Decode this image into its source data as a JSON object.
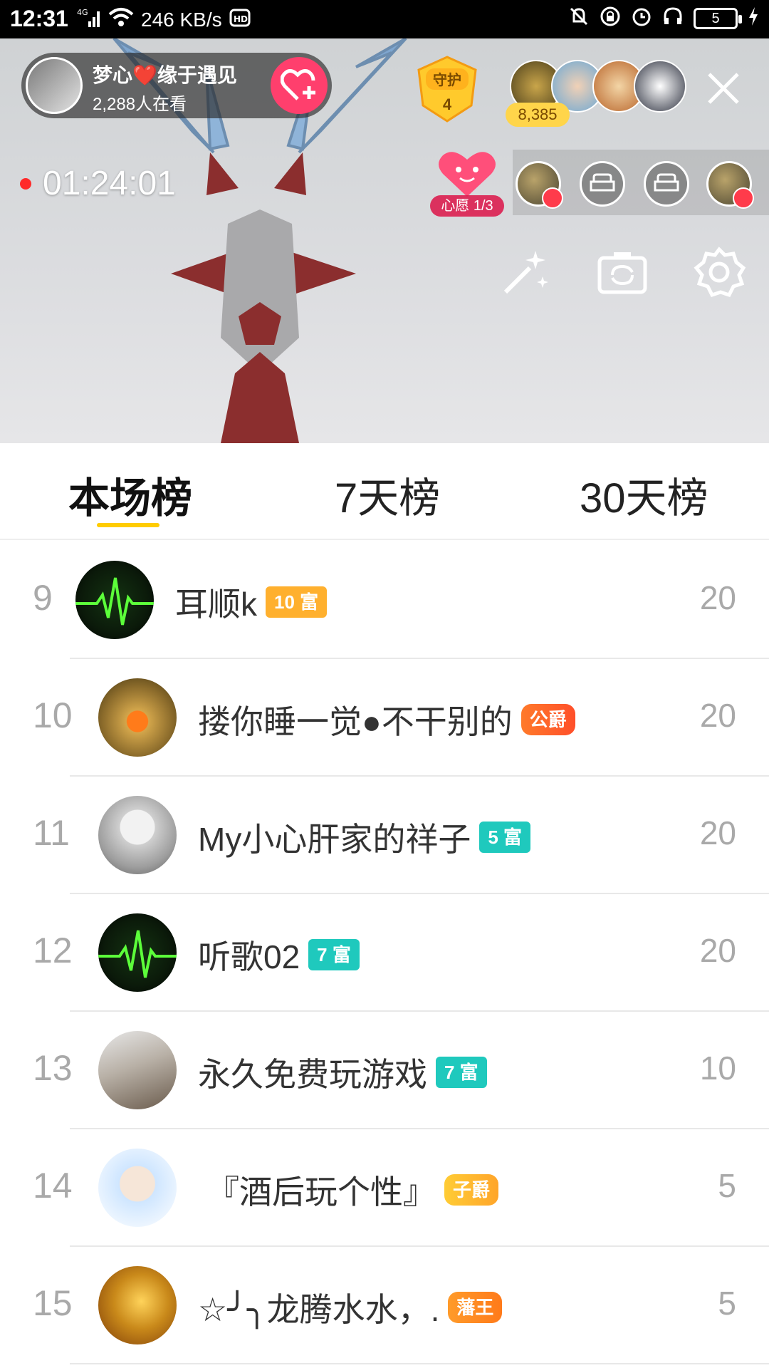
{
  "status_bar": {
    "time": "12:31",
    "network_label": "4G",
    "speed": "246 KB/s",
    "battery_level": "5",
    "icons": [
      "signal-icon",
      "wifi-icon",
      "hd-icon",
      "mute-icon",
      "lock-icon",
      "alarm-icon",
      "headphones-icon",
      "battery-icon",
      "charging-icon"
    ]
  },
  "live": {
    "anchor_name": "梦心❤️缘于遇见",
    "viewers": "2,288人在看",
    "guard_label": "守护",
    "guard_count": "4",
    "audience_count": "8,385",
    "timer": "01:24:01",
    "wish_label": "心愿 1/3",
    "colors": {
      "follow": "#ff3f6d",
      "rec_dot": "#ff2a2a"
    }
  },
  "tabs": [
    {
      "label": "本场榜",
      "active": true
    },
    {
      "label": "7天榜",
      "active": false
    },
    {
      "label": "30天榜",
      "active": false
    }
  ],
  "rankings": [
    {
      "rank": "9",
      "name": "耳顺k",
      "badge": "10 富",
      "badge_style": "gold",
      "score": "20"
    },
    {
      "rank": "10",
      "name": "搂你睡一觉●不干别的",
      "badge": "公爵",
      "badge_style": "orange",
      "score": "20"
    },
    {
      "rank": "11",
      "name": "My小心肝家的祥子",
      "badge": "5 富",
      "badge_style": "teal",
      "score": "20"
    },
    {
      "rank": "12",
      "name": "听歌02",
      "badge": "7 富",
      "badge_style": "teal",
      "score": "20"
    },
    {
      "rank": "13",
      "name": "永久免费玩游戏",
      "badge": "7 富",
      "badge_style": "teal",
      "score": "10"
    },
    {
      "rank": "14",
      "name": "『酒后玩个性』",
      "badge": "子爵",
      "badge_style": "yellow",
      "score": "5"
    },
    {
      "rank": "15",
      "name": "☆╯╮龙腾水水，.",
      "badge": "藩王",
      "badge_style": "amber",
      "score": "5"
    }
  ]
}
